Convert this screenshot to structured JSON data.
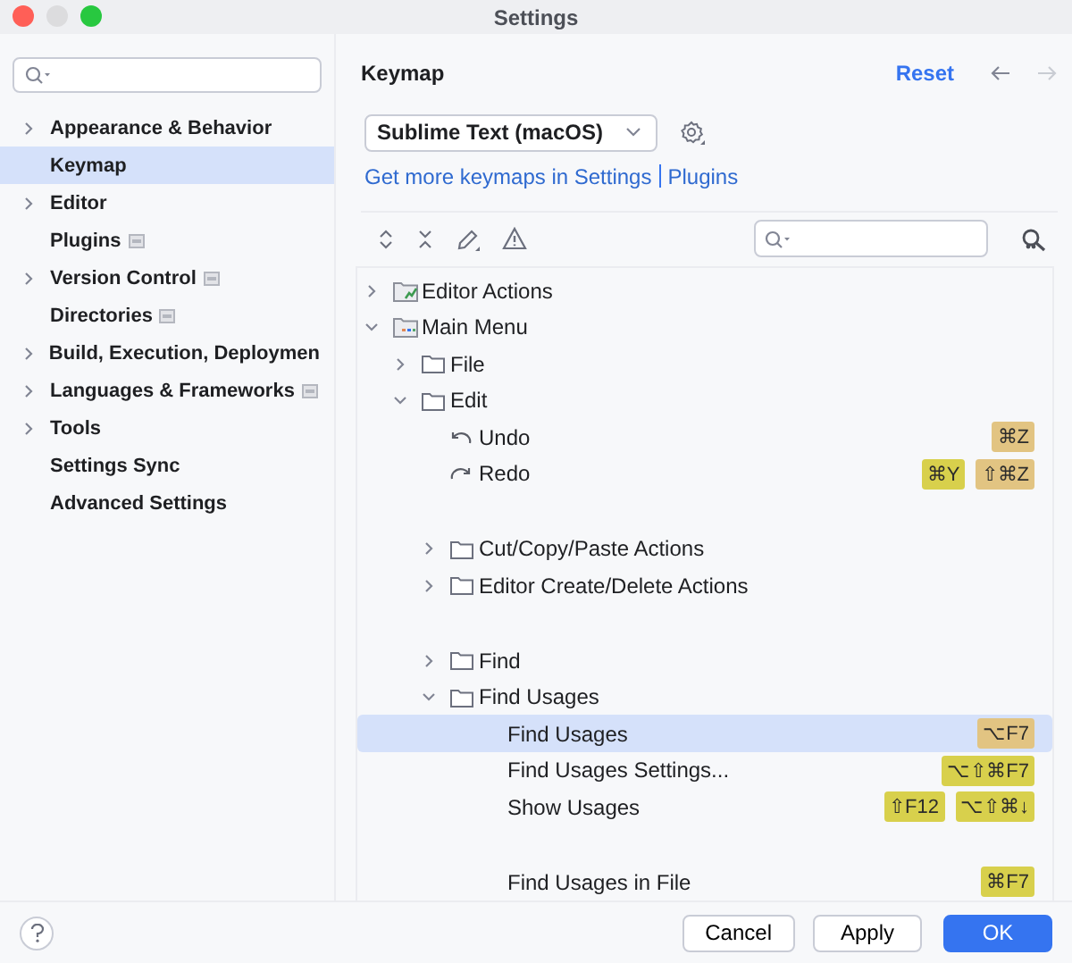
{
  "window": {
    "title": "Settings"
  },
  "sidebar": {
    "items": [
      {
        "label": "Appearance & Behavior",
        "expandable": true,
        "badge": false,
        "selected": false
      },
      {
        "label": "Keymap",
        "expandable": false,
        "badge": false,
        "selected": true
      },
      {
        "label": "Editor",
        "expandable": true,
        "badge": false,
        "selected": false
      },
      {
        "label": "Plugins",
        "expandable": false,
        "badge": true,
        "selected": false
      },
      {
        "label": "Version Control",
        "expandable": true,
        "badge": true,
        "selected": false
      },
      {
        "label": "Directories",
        "expandable": false,
        "badge": true,
        "selected": false
      },
      {
        "label": "Build, Execution, Deploymen",
        "expandable": true,
        "badge": false,
        "selected": false
      },
      {
        "label": "Languages & Frameworks",
        "expandable": true,
        "badge": true,
        "selected": false
      },
      {
        "label": "Tools",
        "expandable": true,
        "badge": false,
        "selected": false
      },
      {
        "label": "Settings Sync",
        "expandable": false,
        "badge": false,
        "selected": false
      },
      {
        "label": "Advanced Settings",
        "expandable": false,
        "badge": false,
        "selected": false
      }
    ]
  },
  "header": {
    "title": "Keymap",
    "reset": "Reset"
  },
  "keymap_select": {
    "value": "Sublime Text (macOS)"
  },
  "links": [
    "Get more keymaps in Settings",
    "Plugins"
  ],
  "tree": [
    {
      "kind": "action-group",
      "label": "Editor Actions",
      "expanded": false,
      "selected": false
    },
    {
      "kind": "menu-group",
      "label": "Main Menu",
      "expanded": true,
      "selected": false,
      "children": [
        {
          "kind": "folder",
          "label": "File",
          "expanded": false,
          "selected": false
        },
        {
          "kind": "folder",
          "label": "Edit",
          "expanded": true,
          "selected": false,
          "children": [
            {
              "kind": "undo",
              "label": "Undo",
              "selected": false,
              "shortcuts": [
                {
                  "keys": "⌘Z",
                  "color": "#e2c482"
                }
              ]
            },
            {
              "kind": "redo",
              "label": "Redo",
              "selected": false,
              "shortcuts": [
                {
                  "keys": "⌘Y",
                  "color": "#d8d04c"
                },
                {
                  "keys": "⇧⌘Z",
                  "color": "#e2c482"
                }
              ]
            },
            {
              "kind": "separator"
            },
            {
              "kind": "folder",
              "label": "Cut/Copy/Paste Actions",
              "expanded": false,
              "selected": false
            },
            {
              "kind": "folder",
              "label": "Editor Create/Delete Actions",
              "expanded": false,
              "selected": false
            },
            {
              "kind": "separator"
            },
            {
              "kind": "folder",
              "label": "Find",
              "expanded": false,
              "selected": false
            },
            {
              "kind": "folder",
              "label": "Find Usages",
              "expanded": true,
              "selected": false,
              "children": [
                {
                  "kind": "action",
                  "label": "Find Usages",
                  "selected": true,
                  "shortcuts": [
                    {
                      "keys": "⌥F7",
                      "color": "#e2c482"
                    }
                  ]
                },
                {
                  "kind": "action",
                  "label": "Find Usages Settings...",
                  "selected": false,
                  "shortcuts": [
                    {
                      "keys": "⌥⇧⌘F7",
                      "color": "#d8d04c"
                    }
                  ]
                },
                {
                  "kind": "action",
                  "label": "Show Usages",
                  "selected": false,
                  "shortcuts": [
                    {
                      "keys": "⇧F12",
                      "color": "#d8d04c"
                    },
                    {
                      "keys": "⌥⇧⌘↓",
                      "color": "#d8d04c"
                    }
                  ]
                },
                {
                  "kind": "separator"
                },
                {
                  "kind": "action",
                  "label": "Find Usages in File",
                  "selected": false,
                  "shortcuts": [
                    {
                      "keys": "⌘F7",
                      "color": "#d8d04c"
                    }
                  ]
                }
              ]
            }
          ]
        }
      ]
    }
  ],
  "buttons": [
    {
      "label": "Cancel",
      "primary": false
    },
    {
      "label": "Apply",
      "primary": false
    },
    {
      "label": "OK",
      "primary": true
    }
  ]
}
